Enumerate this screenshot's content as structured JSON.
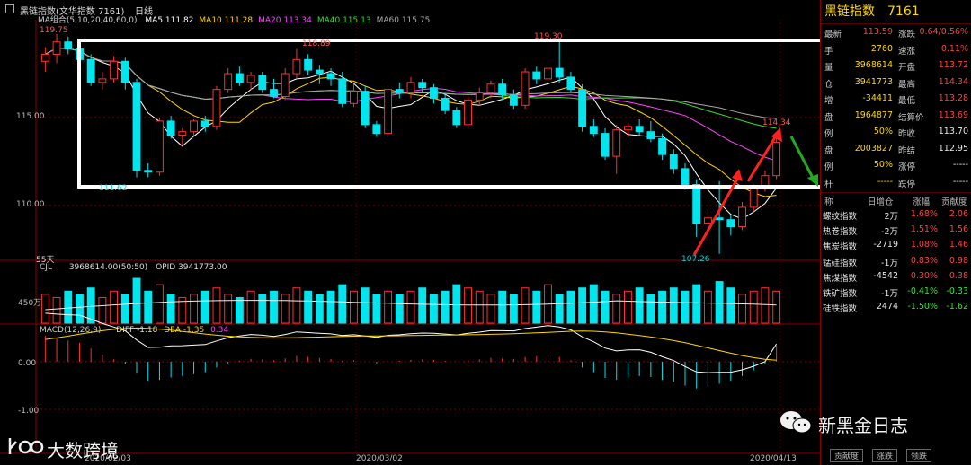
{
  "header": {
    "title": "黑链指数(文华指数 7161)",
    "period": "日线",
    "ma_label": "MA组合(5,10,20,40,60,0)",
    "ma": [
      {
        "name": "MA5",
        "value": "111.82",
        "color": "#ffffff"
      },
      {
        "name": "MA10",
        "value": "111.28",
        "color": "#ffd700"
      },
      {
        "name": "MA20",
        "value": "113.34",
        "color": "#ff44ff"
      },
      {
        "name": "MA40",
        "value": "115.13",
        "color": "#33dd33"
      },
      {
        "name": "MA60",
        "value": "115.75",
        "color": "#aaaaaa"
      }
    ]
  },
  "price_chart": {
    "y_labels": [
      "115.00",
      "110.00"
    ],
    "annotations": {
      "high1": "119.75",
      "high2": "118.89",
      "high3": "119.30",
      "low1": "111.62",
      "low2": "107.26",
      "last_high": "114.34"
    },
    "days_label": "55天"
  },
  "volume_panel": {
    "label": "CJL",
    "value": "3968614.00(50:50)",
    "opid_label": "OPID",
    "opid_value": "3941773.00",
    "y_label": "450万"
  },
  "macd_panel": {
    "label": "MACD(12,26,9)",
    "diff_label": "DIFF",
    "diff": "-1.18",
    "dea_label": "DEA",
    "dea": "-1.35",
    "macd": "0.34",
    "y_labels": [
      "0.00",
      "-1.00"
    ]
  },
  "dates": [
    "2020/02/03",
    "2020/03/02",
    "2020/04/13"
  ],
  "right_panel": {
    "name": "黑链指数",
    "code": "7161",
    "quotes": [
      {
        "l1": "最新",
        "v1": "113.59",
        "c1": "red",
        "l2": "涨跌",
        "v2": "0.64/0.56%",
        "c2": "red"
      },
      {
        "l1": "手",
        "v1": "2760",
        "c1": "yellow",
        "l2": "速涨",
        "v2": "0.11%",
        "c2": "red"
      },
      {
        "l1": "量",
        "v1": "3968614",
        "c1": "yellow",
        "l2": "开盘",
        "v2": "113.72",
        "c2": "red"
      },
      {
        "l1": "仓",
        "v1": "3941773",
        "c1": "yellow",
        "l2": "最高",
        "v2": "114.34",
        "c2": "red"
      },
      {
        "l1": "增",
        "v1": "-34411",
        "c1": "yellow",
        "l2": "最低",
        "v2": "113.28",
        "c2": "red"
      },
      {
        "l1": "盘",
        "v1": "1964877",
        "c1": "yellow",
        "l2": "结算价",
        "v2": "113.69",
        "c2": "red"
      },
      {
        "l1": "例",
        "v1": "50%",
        "c1": "yellow",
        "l2": "昨收",
        "v2": "113.70",
        "c2": "white"
      },
      {
        "l1": "盘",
        "v1": "2003827",
        "c1": "yellow",
        "l2": "昨结",
        "v2": "112.95",
        "c2": "white"
      },
      {
        "l1": "例",
        "v1": "50%",
        "c1": "yellow",
        "l2": "涨停",
        "v2": "-----",
        "c2": "white"
      },
      {
        "l1": "杆",
        "v1": "-----",
        "c1": "yellow",
        "l2": "跌停",
        "v2": "-----",
        "c2": "white"
      }
    ],
    "sector_header": {
      "name": "称",
      "change": "日增仓",
      "pct": "涨幅",
      "contrib": "贡献度"
    },
    "sectors": [
      {
        "name": "螺纹指数",
        "change": "2万",
        "pct": "1.68%",
        "contrib": "2.06",
        "color": "red"
      },
      {
        "name": "热卷指数",
        "change": "-2万",
        "pct": "1.51%",
        "contrib": "1.56",
        "color": "red"
      },
      {
        "name": "焦炭指数",
        "change": "-2719",
        "pct": "1.08%",
        "contrib": "1.46",
        "color": "red"
      },
      {
        "name": "锰硅指数",
        "change": "-1万",
        "pct": "0.83%",
        "contrib": "0.98",
        "color": "red"
      },
      {
        "name": "焦煤指数",
        "change": "-4542",
        "pct": "0.30%",
        "contrib": "0.38",
        "color": "red"
      },
      {
        "name": "铁矿指数",
        "change": "-1万",
        "pct": "-0.41%",
        "contrib": "-0.33",
        "color": "green"
      },
      {
        "name": "硅铁指数",
        "change": "2474",
        "pct": "-1.50%",
        "contrib": "-1.62",
        "color": "green"
      }
    ],
    "tabs": [
      "贡献度",
      "涨跌",
      "领跌"
    ]
  },
  "watermarks": {
    "left": "大数跨境",
    "right": "新黑金日志"
  },
  "candles": [
    [
      118.2,
      119.0,
      117.6,
      118.6
    ],
    [
      118.6,
      119.75,
      118.1,
      119.3
    ],
    [
      119.3,
      119.6,
      118.6,
      118.9
    ],
    [
      118.9,
      119.3,
      118.0,
      118.3
    ],
    [
      118.3,
      118.6,
      116.8,
      117.0
    ],
    [
      117.0,
      117.6,
      116.6,
      117.2
    ],
    [
      117.2,
      118.5,
      117.0,
      118.2
    ],
    [
      118.2,
      118.4,
      116.6,
      117.0
    ],
    [
      117.0,
      117.2,
      111.6,
      112.0
    ],
    [
      112.0,
      112.4,
      111.62,
      111.9
    ],
    [
      111.9,
      115.0,
      111.7,
      114.8
    ],
    [
      114.8,
      115.1,
      113.8,
      114.0
    ],
    [
      114.0,
      114.4,
      113.4,
      114.2
    ],
    [
      114.2,
      114.9,
      113.9,
      114.8
    ],
    [
      114.8,
      115.1,
      114.2,
      114.5
    ],
    [
      114.5,
      116.8,
      114.3,
      116.6
    ],
    [
      116.6,
      117.8,
      116.4,
      117.5
    ],
    [
      117.5,
      117.9,
      116.8,
      117.0
    ],
    [
      117.0,
      117.6,
      116.6,
      117.4
    ],
    [
      117.4,
      117.6,
      116.4,
      116.6
    ],
    [
      116.6,
      117.2,
      116.1,
      116.2
    ],
    [
      116.2,
      117.8,
      116.0,
      117.5
    ],
    [
      117.5,
      118.89,
      117.2,
      118.3
    ],
    [
      118.3,
      118.6,
      117.4,
      117.7
    ],
    [
      117.7,
      118.0,
      116.9,
      117.5
    ],
    [
      117.5,
      117.8,
      116.8,
      117.2
    ],
    [
      117.2,
      117.6,
      115.6,
      115.8
    ],
    [
      115.8,
      116.9,
      115.6,
      116.5
    ],
    [
      116.5,
      116.8,
      114.4,
      114.6
    ],
    [
      114.6,
      114.8,
      113.9,
      114.1
    ],
    [
      114.1,
      116.8,
      113.9,
      116.6
    ],
    [
      116.6,
      117.0,
      116.1,
      116.4
    ],
    [
      116.4,
      117.3,
      116.1,
      117.0
    ],
    [
      117.0,
      117.2,
      116.4,
      116.7
    ],
    [
      116.7,
      116.9,
      115.8,
      116.1
    ],
    [
      116.1,
      116.4,
      115.2,
      115.4
    ],
    [
      115.4,
      115.6,
      114.4,
      114.6
    ],
    [
      114.6,
      116.2,
      114.5,
      116.0
    ],
    [
      116.0,
      116.7,
      115.7,
      116.4
    ],
    [
      116.4,
      117.1,
      116.1,
      116.9
    ],
    [
      116.9,
      117.2,
      116.0,
      116.3
    ],
    [
      116.3,
      116.6,
      115.5,
      115.7
    ],
    [
      115.7,
      117.8,
      115.5,
      117.6
    ],
    [
      117.6,
      117.9,
      116.9,
      117.2
    ],
    [
      117.2,
      118.0,
      117.0,
      117.8
    ],
    [
      117.8,
      119.3,
      117.0,
      117.3
    ],
    [
      117.3,
      117.6,
      116.4,
      116.6
    ],
    [
      116.6,
      116.9,
      114.2,
      114.5
    ],
    [
      114.5,
      114.9,
      113.9,
      114.1
    ],
    [
      114.1,
      114.4,
      112.6,
      112.8
    ],
    [
      112.8,
      114.6,
      111.8,
      114.3
    ],
    [
      114.3,
      114.7,
      113.9,
      114.5
    ],
    [
      114.5,
      114.9,
      114.0,
      114.2
    ],
    [
      114.2,
      114.8,
      113.6,
      113.8
    ],
    [
      113.8,
      114.1,
      112.6,
      112.9
    ],
    [
      112.9,
      113.2,
      111.8,
      112.1
    ],
    [
      112.1,
      112.4,
      110.9,
      111.2
    ],
    [
      111.2,
      111.5,
      108.2,
      109.0
    ],
    [
      109.0,
      109.8,
      108.0,
      109.3
    ],
    [
      109.3,
      111.4,
      107.26,
      109.2
    ],
    [
      109.2,
      109.5,
      108.3,
      108.8
    ],
    [
      108.8,
      110.2,
      108.6,
      109.9
    ],
    [
      109.9,
      111.2,
      109.7,
      111.0
    ],
    [
      111.0,
      112.0,
      110.8,
      111.7
    ],
    [
      111.7,
      113.9,
      111.5,
      113.6
    ]
  ],
  "volumes": [
    9,
    8,
    10,
    9,
    11,
    8,
    10,
    9,
    14,
    10,
    12,
    9,
    8,
    9,
    10,
    11,
    9,
    8,
    10,
    9,
    10,
    9,
    11,
    10,
    9,
    10,
    12,
    10,
    11,
    9,
    10,
    9,
    10,
    11,
    9,
    10,
    12,
    11,
    10,
    9,
    10,
    9,
    11,
    10,
    12,
    9,
    10,
    11,
    12,
    10,
    9,
    10,
    11,
    9,
    10,
    11,
    10,
    12,
    10,
    13,
    11,
    9,
    10,
    11,
    10
  ],
  "macd_hist": [
    0.55,
    0.5,
    0.45,
    0.4,
    0.28,
    0.15,
    0.05,
    -0.05,
    -0.25,
    -0.4,
    -0.38,
    -0.33,
    -0.3,
    -0.26,
    -0.22,
    -0.12,
    -0.03,
    0.02,
    0.06,
    0.05,
    0.03,
    0.07,
    0.12,
    0.1,
    0.08,
    0.06,
    0.02,
    0.03,
    0.0,
    -0.03,
    0.01,
    0.02,
    0.04,
    0.05,
    0.04,
    0.02,
    0.0,
    0.03,
    0.05,
    0.08,
    0.07,
    0.06,
    0.1,
    0.12,
    0.14,
    0.1,
    0.03,
    -0.12,
    -0.22,
    -0.34,
    -0.38,
    -0.33,
    -0.3,
    -0.32,
    -0.38,
    -0.42,
    -0.5,
    -0.56,
    -0.52,
    -0.46,
    -0.4,
    -0.3,
    -0.18,
    -0.05,
    0.34
  ]
}
